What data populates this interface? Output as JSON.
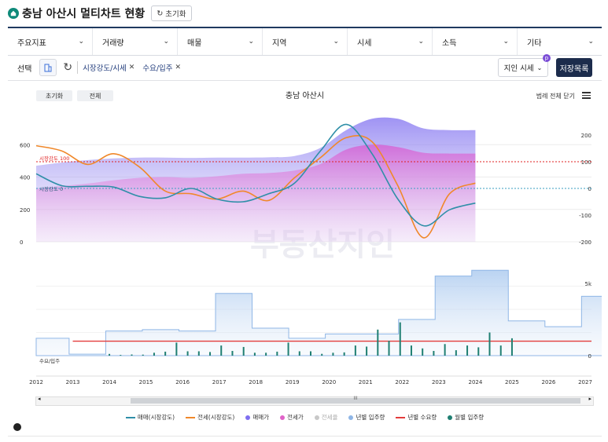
{
  "header": {
    "title": "충남 아산시 멀티차트 현황",
    "reset_label": "초기화"
  },
  "menus": [
    {
      "label": "주요지표"
    },
    {
      "label": "거래량"
    },
    {
      "label": "매물"
    },
    {
      "label": "지역"
    },
    {
      "label": "시세"
    },
    {
      "label": "소득"
    },
    {
      "label": "기타"
    }
  ],
  "selection": {
    "label": "선택",
    "chips": [
      {
        "label": "시장강도/시세"
      },
      {
        "label": "수요/입주"
      }
    ],
    "dropdown_label": "지인 시세",
    "badge": "p",
    "save_label": "저장목록"
  },
  "chart_toolbar": {
    "reset": "초기화",
    "all": "전체",
    "title": "충남 아산시",
    "legend_close": "범례 전체 닫기"
  },
  "chart_data": {
    "type": "line",
    "x_axis": {
      "ticks": [
        "2012",
        "2013",
        "2014",
        "2015",
        "2016",
        "2017",
        "2018",
        "2019",
        "2020",
        "2021",
        "2022",
        "2023",
        "2024",
        "2025",
        "2026",
        "2027"
      ]
    },
    "upper": {
      "left_ticks": [
        "600",
        "400",
        "200",
        "0"
      ],
      "right_ticks": [
        "200",
        "100",
        "0",
        "-100",
        "-200"
      ],
      "ref_lines": [
        {
          "label": "시장강도 100",
          "color": "#e02020"
        },
        {
          "label": "시장강도 0",
          "color": "#3a9ec2"
        }
      ],
      "series": [
        {
          "name": "매매(시장강도)",
          "color": "#2f8fa8",
          "values": [
            55,
            10,
            8,
            5,
            -30,
            -35,
            0,
            -40,
            -50,
            -20,
            20,
            140,
            240,
            130,
            -40,
            -140,
            -80,
            -55
          ]
        },
        {
          "name": "전세(시장강도)",
          "color": "#f0882a",
          "values": [
            160,
            140,
            90,
            130,
            80,
            -10,
            -20,
            -40,
            -10,
            -45,
            40,
            115,
            190,
            175,
            10,
            -185,
            -20,
            20
          ]
        },
        {
          "name": "매매가",
          "color": "#7f6ff0",
          "values": [
            470,
            490,
            505,
            515,
            520,
            520,
            518,
            520,
            520,
            522,
            530,
            580,
            690,
            760,
            760,
            700,
            690,
            690
          ]
        },
        {
          "name": "전세가",
          "color": "#e063c8",
          "values": [
            330,
            345,
            360,
            380,
            395,
            400,
            395,
            405,
            420,
            425,
            440,
            480,
            570,
            600,
            585,
            550,
            545,
            545
          ]
        }
      ]
    },
    "lower": {
      "label": "수요/입주",
      "right_ticks": [
        "5k",
        "0"
      ],
      "series": [
        {
          "name": "년별 입주량",
          "color": "#8fb6e6",
          "values": [
            1200,
            100,
            1700,
            1800,
            1700,
            4300,
            1900,
            1200,
            1500,
            1500,
            2500,
            5500,
            5900,
            2400,
            2000,
            4100
          ]
        },
        {
          "name": "년별 수요량",
          "color": "#e33c3c",
          "values": [
            1000,
            1000,
            1000,
            1000,
            1000,
            1000,
            1000,
            1000,
            1000,
            1000,
            1000,
            1000,
            1000,
            1000,
            1000,
            1000
          ]
        },
        {
          "name": "월별 입주량",
          "color": "#1f7f72",
          "values": [
            120,
            80,
            200,
            900,
            300,
            700,
            600,
            200,
            900,
            300,
            200,
            700,
            1800,
            2300,
            500,
            800,
            700,
            1600,
            1200
          ]
        }
      ]
    },
    "legend": [
      {
        "name": "매매(시장강도)",
        "color": "#2f8fa8",
        "kind": "line"
      },
      {
        "name": "전세(시장강도)",
        "color": "#f0882a",
        "kind": "line"
      },
      {
        "name": "매매가",
        "color": "#7f6ff0",
        "kind": "dot"
      },
      {
        "name": "전세가",
        "color": "#e063c8",
        "kind": "dot"
      },
      {
        "name": "전세율",
        "color": "#c8c8c8",
        "kind": "dot"
      },
      {
        "name": "년별 입주량",
        "color": "#8fb6e6",
        "kind": "dot"
      },
      {
        "name": "년별 수요량",
        "color": "#e33c3c",
        "kind": "line"
      },
      {
        "name": "월별 입주량",
        "color": "#1f7f72",
        "kind": "dot"
      }
    ]
  },
  "watermark": "부동산지인",
  "scrollbar": {
    "thumb_label": "III"
  }
}
